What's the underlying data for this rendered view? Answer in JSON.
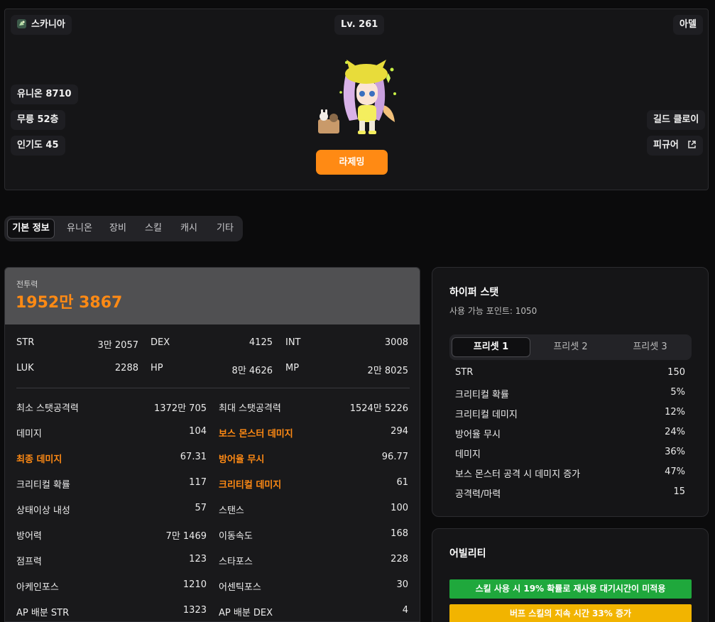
{
  "character": {
    "world": "스카니아",
    "level": "Lv. 261",
    "job": "아델",
    "union": "유니온 8710",
    "dojang": "무릉 52층",
    "popularity": "인기도 45",
    "guild": "길드 클로이",
    "figure": "피규어",
    "rank_button": "라제밍"
  },
  "tabs": [
    "기본 정보",
    "유니온",
    "장비",
    "스킬",
    "캐시",
    "기타"
  ],
  "combat": {
    "label": "전투력",
    "value": "1952만 3867"
  },
  "base_stats": [
    {
      "name": "STR",
      "value": "3만 2057"
    },
    {
      "name": "DEX",
      "value": "4125"
    },
    {
      "name": "INT",
      "value": "3008"
    },
    {
      "name": "LUK",
      "value": "2288"
    },
    {
      "name": "HP",
      "value": "8만 4626"
    },
    {
      "name": "MP",
      "value": "2만 8025"
    }
  ],
  "detail_stats": [
    {
      "name": "최소 스탯공격력",
      "value": "1372만 705",
      "hl": false
    },
    {
      "name": "최대 스탯공격력",
      "value": "1524만 5226",
      "hl": false
    },
    {
      "name": "데미지",
      "value": "104",
      "hl": false
    },
    {
      "name": "보스 몬스터 데미지",
      "value": "294",
      "hl": true
    },
    {
      "name": "최종 데미지",
      "value": "67.31",
      "hl": true
    },
    {
      "name": "방어율 무시",
      "value": "96.77",
      "hl": true
    },
    {
      "name": "크리티컬 확률",
      "value": "117",
      "hl": false
    },
    {
      "name": "크리티컬 데미지",
      "value": "61",
      "hl": true
    },
    {
      "name": "상태이상 내성",
      "value": "57",
      "hl": false
    },
    {
      "name": "스탠스",
      "value": "100",
      "hl": false
    },
    {
      "name": "방어력",
      "value": "7만 1469",
      "hl": false
    },
    {
      "name": "이동속도",
      "value": "168",
      "hl": false
    },
    {
      "name": "점프력",
      "value": "123",
      "hl": false
    },
    {
      "name": "스타포스",
      "value": "228",
      "hl": false
    },
    {
      "name": "아케인포스",
      "value": "1210",
      "hl": false
    },
    {
      "name": "어센틱포스",
      "value": "30",
      "hl": false
    },
    {
      "name": "AP 배분 STR",
      "value": "1323",
      "hl": false
    },
    {
      "name": "AP 배분 DEX",
      "value": "4",
      "hl": false
    }
  ],
  "hyper": {
    "title": "하이퍼 스탯",
    "points": "사용 가능 포인트: 1050",
    "presets": [
      "프리셋 1",
      "프리셋 2",
      "프리셋 3"
    ],
    "rows": [
      {
        "name": "STR",
        "value": "150"
      },
      {
        "name": "크리티컬 확률",
        "value": "5%"
      },
      {
        "name": "크리티컬 데미지",
        "value": "12%"
      },
      {
        "name": "방어율 무시",
        "value": "24%"
      },
      {
        "name": "데미지",
        "value": "36%"
      },
      {
        "name": "보스 몬스터 공격 시 데미지 증가",
        "value": "47%"
      },
      {
        "name": "공격력/마력",
        "value": "15"
      }
    ]
  },
  "ability": {
    "title": "어빌리티",
    "lines": [
      {
        "text": "스킬 사용 시 19% 확률로 재사용 대기시간이 미적용",
        "color": "#1fa83c"
      },
      {
        "text": "버프 스킬의 지속 시간 33% 증가",
        "color": "#f2b400"
      }
    ]
  },
  "colors": {
    "accent": "#ff8a14"
  }
}
